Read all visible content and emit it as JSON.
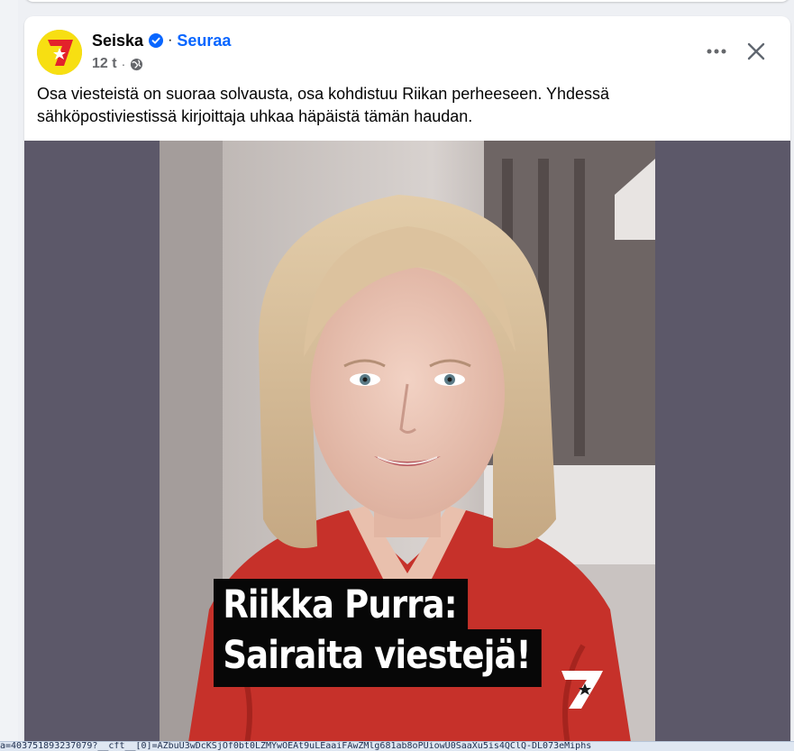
{
  "post": {
    "page_name": "Seiska",
    "separator": "·",
    "follow_label": "Seuraa",
    "time": "12 t",
    "meta_separator": "·",
    "audience_icon": "globe-icon",
    "verified_icon": "verified-badge-icon",
    "text": "Osa viesteistä on suoraa solvausta, osa kohdistuu Riikan perheeseen. Yhdessä sähköpostiviestissä kirjoittaja uhkaa häpäistä tämän haudan.",
    "image": {
      "caption_line1": "Riikka Purra:",
      "caption_line2": "Sairaita viestejä!",
      "logo": "7"
    }
  },
  "actions": {
    "more_icon": "more-horizontal-icon",
    "close_icon": "close-icon"
  },
  "status_bar": {
    "url": "a=403751893237079?__cft__[0]=AZbuU3wDcKSjOf0bt0LZMYwOEAt9uLEaaiFAwZMlg681ab8oPUiowU0SaaXu5is4QClQ-DL073eMiphs"
  },
  "colors": {
    "accent": "#0866ff",
    "logo_yellow": "#f7df12",
    "logo_red": "#e3222b",
    "media_bg": "#5c5869"
  }
}
